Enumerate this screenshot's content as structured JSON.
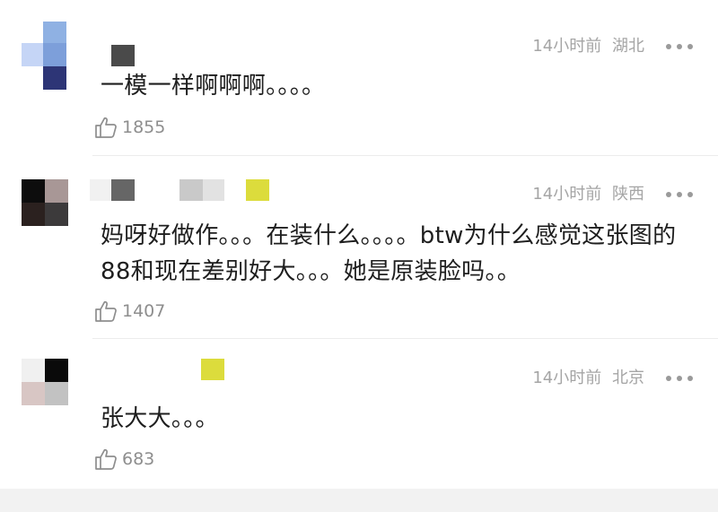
{
  "comments": [
    {
      "time": "14小时前",
      "location": "湖北",
      "text": "一模一样啊啊啊。。。。",
      "likes": "1855"
    },
    {
      "time": "14小时前",
      "location": "陕西",
      "text": "妈呀好做作。。。在装什么。。。。btw为什么感觉这张图的88和现在差别好大。。。她是原装脸吗。。",
      "likes": "1407"
    },
    {
      "time": "14小时前",
      "location": "北京",
      "text": "张大大。。。",
      "likes": "683"
    }
  ],
  "icons": {
    "like": "thumbs-up-icon",
    "more": "more-dots-icon"
  },
  "colors": {
    "meta_text": "#a5a5a5",
    "body_text": "#1e1e1e",
    "name_accent": "#dcdc3c"
  }
}
